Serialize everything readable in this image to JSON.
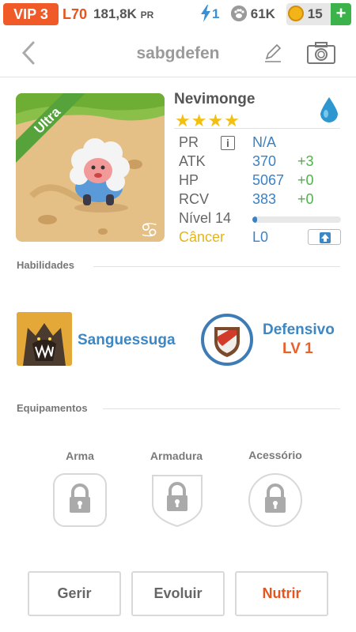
{
  "status": {
    "vip": "VIP 3",
    "level": "L70",
    "power": "181,8K",
    "power_unit": "PR",
    "energy": "1",
    "paws": "61K",
    "coins": "15",
    "plus": "+"
  },
  "header": {
    "title": "sabgdefen"
  },
  "pet": {
    "rarity": "Ultra",
    "name": "Nevimonge",
    "stars": "★★★★",
    "stats": {
      "pr_label": "PR",
      "pr_info": "i",
      "pr_value": "N/A",
      "atk_label": "ATK",
      "atk_value": "370",
      "atk_delta": "+3",
      "hp_label": "HP",
      "hp_value": "5067",
      "hp_delta": "+0",
      "rcv_label": "RCV",
      "rcv_value": "383",
      "rcv_delta": "+0",
      "level_label": "Nível 14",
      "level_progress": 0.05,
      "sign_label": "Câncer",
      "sign_value": "L0"
    }
  },
  "abilities": {
    "title": "Habilidades",
    "skill_name": "Sanguessuga",
    "leader_name": "Defensivo",
    "leader_level": "LV 1"
  },
  "equipment": {
    "title": "Equipamentos",
    "slots": [
      {
        "label": "Arma"
      },
      {
        "label": "Armadura"
      },
      {
        "label": "Acessório"
      }
    ]
  },
  "actions": {
    "manage": "Gerir",
    "evolve": "Evoluir",
    "feed": "Nutrir"
  },
  "colors": {
    "vip": "#f05a28",
    "accent_blue": "#3b82c4",
    "accent_orange": "#e8541e",
    "bonus_green": "#4db34a",
    "star_gold": "#f3c011"
  }
}
